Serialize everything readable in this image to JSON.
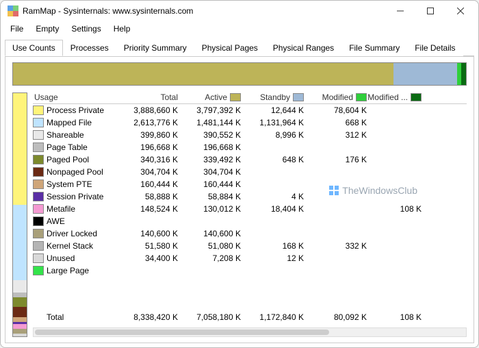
{
  "window": {
    "title": "RamMap - Sysinternals: www.sysinternals.com"
  },
  "menus": [
    "File",
    "Empty",
    "Settings",
    "Help"
  ],
  "tabs": [
    "Use Counts",
    "Processes",
    "Priority Summary",
    "Physical Pages",
    "Physical Ranges",
    "File Summary",
    "File Details"
  ],
  "active_tab": 0,
  "columns": {
    "usage": "Usage",
    "total": "Total",
    "active": "Active",
    "standby": "Standby",
    "modified": "Modified",
    "modified_nowrite": "Modified ..."
  },
  "column_swatches": {
    "active": "#bdb458",
    "standby": "#9eb9d6",
    "modified": "#2fcf3b",
    "modified_nowrite": "#0a6b12"
  },
  "rows": [
    {
      "label": "Process Private",
      "color": "#fff47a",
      "total": "3,888,660 K",
      "active": "3,797,392 K",
      "standby": "12,644 K",
      "modified": "78,604 K",
      "modn": ""
    },
    {
      "label": "Mapped File",
      "color": "#bfe4ff",
      "total": "2,613,776 K",
      "active": "1,481,144 K",
      "standby": "1,131,964 K",
      "modified": "668 K",
      "modn": ""
    },
    {
      "label": "Shareable",
      "color": "#e9e9e9",
      "total": "399,860 K",
      "active": "390,552 K",
      "standby": "8,996 K",
      "modified": "312 K",
      "modn": ""
    },
    {
      "label": "Page Table",
      "color": "#bdbdbd",
      "total": "196,668 K",
      "active": "196,668 K",
      "standby": "",
      "modified": "",
      "modn": ""
    },
    {
      "label": "Paged Pool",
      "color": "#7d8a2d",
      "total": "340,316 K",
      "active": "339,492 K",
      "standby": "648 K",
      "modified": "176 K",
      "modn": ""
    },
    {
      "label": "Nonpaged Pool",
      "color": "#6b2a14",
      "total": "304,704 K",
      "active": "304,704 K",
      "standby": "",
      "modified": "",
      "modn": ""
    },
    {
      "label": "System PTE",
      "color": "#cfa67a",
      "total": "160,444 K",
      "active": "160,444 K",
      "standby": "",
      "modified": "",
      "modn": ""
    },
    {
      "label": "Session Private",
      "color": "#5a2fa5",
      "total": "58,888 K",
      "active": "58,884 K",
      "standby": "4 K",
      "modified": "",
      "modn": ""
    },
    {
      "label": "Metafile",
      "color": "#f49ad2",
      "total": "148,524 K",
      "active": "130,012 K",
      "standby": "18,404 K",
      "modified": "",
      "modn": "108 K"
    },
    {
      "label": "AWE",
      "color": "#000000",
      "total": "",
      "active": "",
      "standby": "",
      "modified": "",
      "modn": ""
    },
    {
      "label": "Driver Locked",
      "color": "#a9a07a",
      "total": "140,600 K",
      "active": "140,600 K",
      "standby": "",
      "modified": "",
      "modn": ""
    },
    {
      "label": "Kernel Stack",
      "color": "#b5b5b5",
      "total": "51,580 K",
      "active": "51,080 K",
      "standby": "168 K",
      "modified": "332 K",
      "modn": ""
    },
    {
      "label": "Unused",
      "color": "#d9d9d9",
      "total": "34,400 K",
      "active": "7,208 K",
      "standby": "12 K",
      "modified": "",
      "modn": ""
    },
    {
      "label": "Large Page",
      "color": "#34e34b",
      "total": "",
      "active": "",
      "standby": "",
      "modified": "",
      "modn": ""
    }
  ],
  "totals": {
    "label": "Total",
    "total": "8,338,420 K",
    "active": "7,058,180 K",
    "standby": "1,172,840 K",
    "modified": "80,092 K",
    "modn": "108 K"
  },
  "hbar": [
    {
      "color": "#bdb458",
      "pct": 84
    },
    {
      "color": "#9eb9d6",
      "pct": 14
    },
    {
      "color": "#2fcf3b",
      "pct": 1
    },
    {
      "color": "#0a6b12",
      "pct": 1
    }
  ],
  "vbar": [
    {
      "color": "#fff47a",
      "pct": 46
    },
    {
      "color": "#bfe4ff",
      "pct": 31
    },
    {
      "color": "#e9e9e9",
      "pct": 5
    },
    {
      "color": "#bdbdbd",
      "pct": 2
    },
    {
      "color": "#7d8a2d",
      "pct": 4
    },
    {
      "color": "#6b2a14",
      "pct": 4
    },
    {
      "color": "#cfa67a",
      "pct": 2
    },
    {
      "color": "#5a2fa5",
      "pct": 1
    },
    {
      "color": "#f49ad2",
      "pct": 2
    },
    {
      "color": "#a9a07a",
      "pct": 2
    },
    {
      "color": "#d9d9d9",
      "pct": 1
    }
  ],
  "watermark": "TheWindowsClub",
  "chart_data": {
    "type": "table",
    "title": "RamMap Use Counts",
    "columns": [
      "Usage",
      "Total",
      "Active",
      "Standby",
      "Modified",
      "Modified No-Write"
    ],
    "series": [
      {
        "name": "Process Private",
        "values": [
          3888660,
          3797392,
          12644,
          78604,
          null
        ]
      },
      {
        "name": "Mapped File",
        "values": [
          2613776,
          1481144,
          1131964,
          668,
          null
        ]
      },
      {
        "name": "Shareable",
        "values": [
          399860,
          390552,
          8996,
          312,
          null
        ]
      },
      {
        "name": "Page Table",
        "values": [
          196668,
          196668,
          null,
          null,
          null
        ]
      },
      {
        "name": "Paged Pool",
        "values": [
          340316,
          339492,
          648,
          176,
          null
        ]
      },
      {
        "name": "Nonpaged Pool",
        "values": [
          304704,
          304704,
          null,
          null,
          null
        ]
      },
      {
        "name": "System PTE",
        "values": [
          160444,
          160444,
          null,
          null,
          null
        ]
      },
      {
        "name": "Session Private",
        "values": [
          58888,
          58884,
          4,
          null,
          null
        ]
      },
      {
        "name": "Metafile",
        "values": [
          148524,
          130012,
          18404,
          null,
          108
        ]
      },
      {
        "name": "AWE",
        "values": [
          null,
          null,
          null,
          null,
          null
        ]
      },
      {
        "name": "Driver Locked",
        "values": [
          140600,
          140600,
          null,
          null,
          null
        ]
      },
      {
        "name": "Kernel Stack",
        "values": [
          51580,
          51080,
          168,
          332,
          null
        ]
      },
      {
        "name": "Unused",
        "values": [
          34400,
          7208,
          12,
          null,
          null
        ]
      },
      {
        "name": "Large Page",
        "values": [
          null,
          null,
          null,
          null,
          null
        ]
      }
    ],
    "totals": [
      8338420,
      7058180,
      1172840,
      80092,
      108
    ],
    "unit": "K"
  }
}
